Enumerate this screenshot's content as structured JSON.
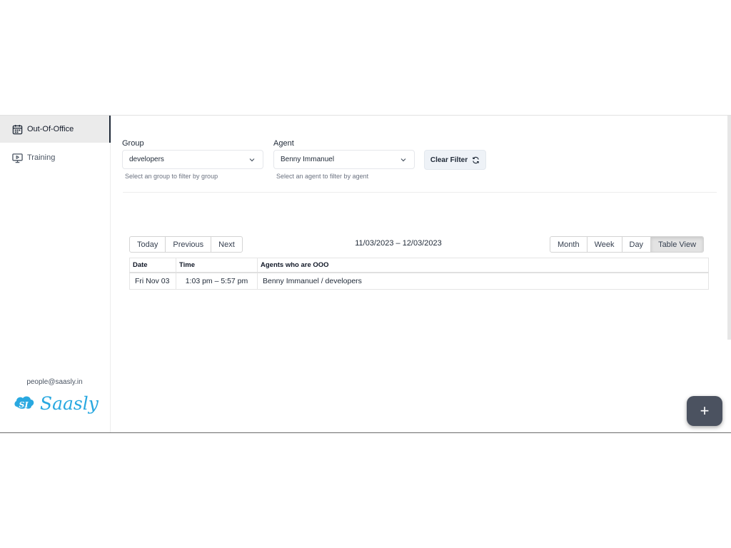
{
  "sidebar": {
    "items": [
      {
        "label": "Out-Of-Office",
        "icon": "calendar-icon",
        "active": true
      },
      {
        "label": "Training",
        "icon": "presentation-icon",
        "active": false
      }
    ],
    "email": "people@saasly.in",
    "logo_text": "Saasly"
  },
  "filters": {
    "group": {
      "label": "Group",
      "value": "developers",
      "hint": "Select an group to filter by group"
    },
    "agent": {
      "label": "Agent",
      "value": "Benny Immanuel",
      "hint": "Select an agent to filter by agent"
    },
    "clear_label": "Clear Filter"
  },
  "calendar": {
    "nav_buttons": [
      "Today",
      "Previous",
      "Next"
    ],
    "range": "11/03/2023 – 12/03/2023",
    "view_buttons": [
      "Month",
      "Week",
      "Day",
      "Table View"
    ],
    "active_view": "Table View",
    "columns": [
      "Date",
      "Time",
      "Agents who are OOO"
    ],
    "rows": [
      [
        "Fri Nov 03",
        "1:03 pm – 5:57 pm",
        "Benny Immanuel / developers"
      ]
    ]
  },
  "fab": {
    "label": "+",
    "icon": "plus-icon"
  },
  "colors": {
    "accent": "#29a8e0",
    "fab": "#4b5260",
    "active_nav": "#ebebeb"
  }
}
